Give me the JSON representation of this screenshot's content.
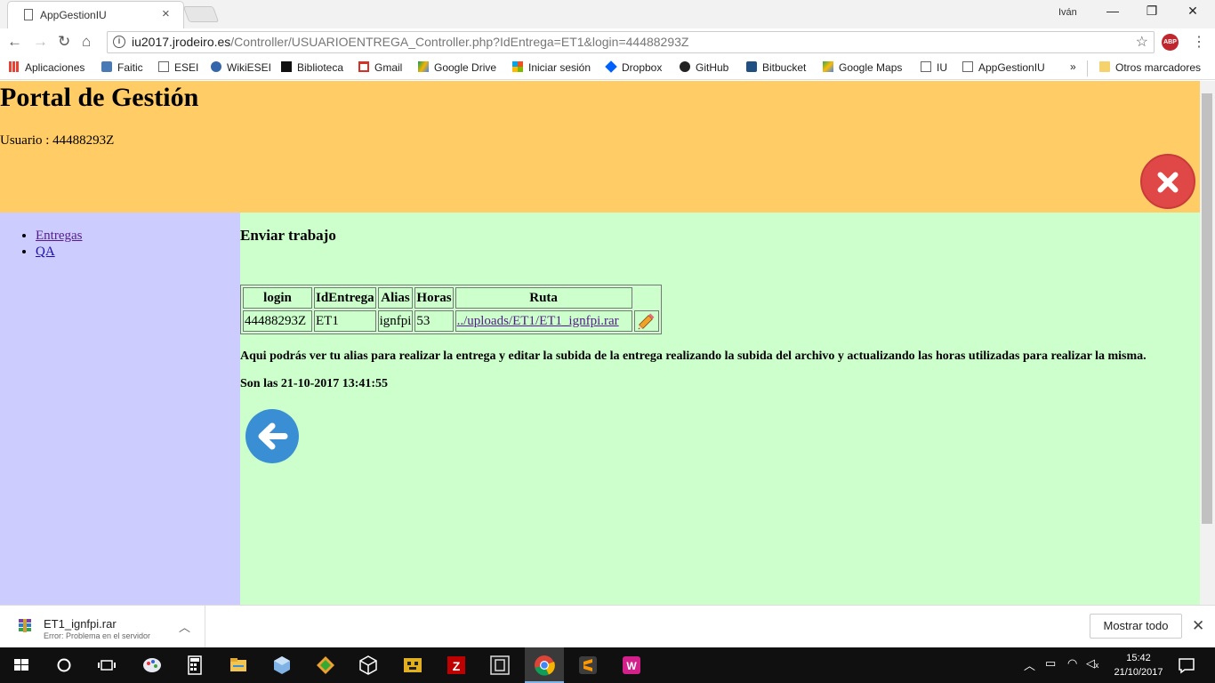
{
  "browser": {
    "tab_title": "AppGestionIU",
    "tab_close": "×",
    "profile": "Iván",
    "url_host": "iu2017.jrodeiro.es",
    "url_path": "/Controller/USUARIOENTREGA_Controller.php?IdEntrega=ET1&login=44488293Z",
    "abp_label": "ABP",
    "bookmarks": [
      "Aplicaciones",
      "Faitic",
      "ESEI",
      "WikiESEI",
      "Biblioteca",
      "Gmail",
      "Google Drive",
      "Iniciar sesión",
      "Dropbox",
      "GitHub",
      "Bitbucket",
      "Google Maps",
      "IU",
      "AppGestionIU"
    ],
    "bookmarks_more": "»",
    "other_bookmarks": "Otros marcadores"
  },
  "page": {
    "title": "Portal de Gestión",
    "user_label": "Usuario : 44488293Z",
    "nav": [
      "Entregas",
      "QA"
    ],
    "section_title": "Enviar trabajo",
    "table": {
      "headers": [
        "login",
        "IdEntrega",
        "Alias",
        "Horas",
        "Ruta"
      ],
      "row": {
        "login": "44488293Z",
        "id_entrega": "ET1",
        "alias": "ignfpi",
        "horas": "53",
        "ruta": "../uploads/ET1/ET1_ignfpi.rar"
      }
    },
    "description": "Aqui podrás ver tu alias para realizar la entrega y editar la subida de la entrega realizando la subida del archivo y actualizando las horas utilizadas para realizar la misma.",
    "timestamp": "Son las 21-10-2017 13:41:55"
  },
  "downloads": {
    "file_name": "ET1_ignfpi.rar",
    "status": "Error: Problema en el servidor",
    "show_all": "Mostrar todo"
  },
  "taskbar": {
    "time": "15:42",
    "date": "21/10/2017"
  },
  "colors": {
    "header": "#ffcc66",
    "sidebar": "#ccccff",
    "content": "#ccffcc"
  }
}
